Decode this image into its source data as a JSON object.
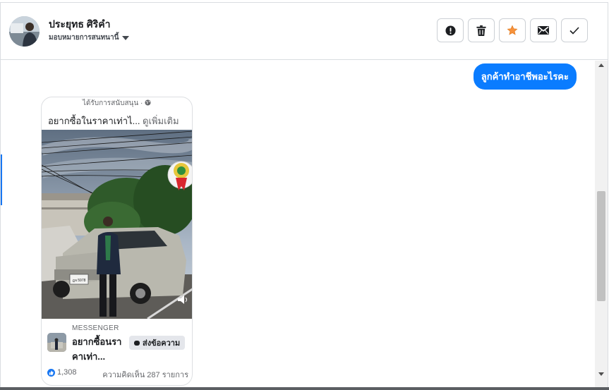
{
  "header": {
    "user_name": "ประยุทธ ศิริคำ",
    "assign_label": "มอบหมายการสนทนานี้",
    "actions": [
      {
        "name": "report-button",
        "icon": "exclamation-circle-icon"
      },
      {
        "name": "delete-button",
        "icon": "trash-icon"
      },
      {
        "name": "star-button",
        "icon": "star-icon",
        "color": "#f7923b"
      },
      {
        "name": "mail-button",
        "icon": "envelope-icon"
      },
      {
        "name": "done-button",
        "icon": "checkmark-icon"
      }
    ]
  },
  "conversation": {
    "outgoing_message": "ลูกค้าทำอาชีพอะไรคะ",
    "ad": {
      "sponsored_label": "ได้รับการสนับสนุน · ",
      "headline": "อยากซื้อในราคาเท่าไ...",
      "see_more": " ดูเพิ่มเติม",
      "platform_label": "MESSENGER",
      "title": "อยากซื้อนราคาเท่า...",
      "send_button": "ส่งข้อความ",
      "likes": "1,308",
      "comments": "ความคิดเห็น 287 รายการ",
      "plate_text": "ฎจ 5978"
    }
  },
  "colors": {
    "accent": "#0a7cff",
    "star": "#f7923b",
    "border": "#dadde1"
  }
}
